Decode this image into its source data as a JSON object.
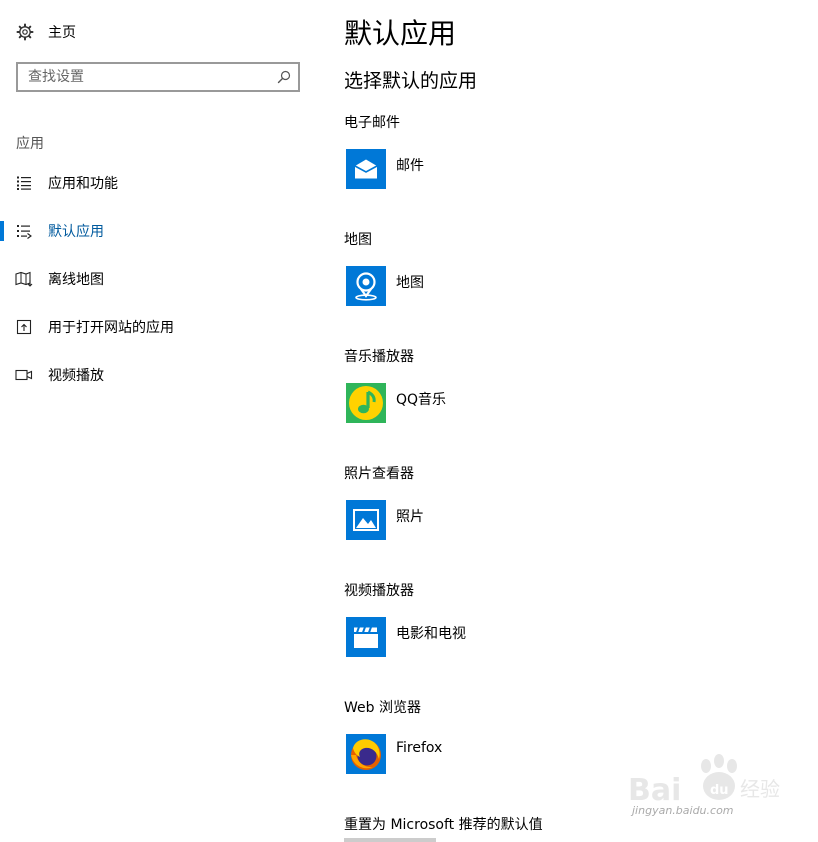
{
  "sidebar": {
    "home_label": "主页",
    "search_placeholder": "查找设置",
    "section_label": "应用",
    "items": [
      {
        "label": "应用和功能",
        "icon": "list-icon"
      },
      {
        "label": "默认应用",
        "icon": "default-apps-icon",
        "active": true
      },
      {
        "label": "离线地图",
        "icon": "offline-map-icon"
      },
      {
        "label": "用于打开网站的应用",
        "icon": "open-website-icon"
      },
      {
        "label": "视频播放",
        "icon": "video-camera-icon"
      }
    ]
  },
  "main": {
    "title": "默认应用",
    "subtitle": "选择默认的应用",
    "categories": [
      {
        "label": "电子邮件",
        "app": "邮件",
        "icon": "mail-app-icon",
        "color": "#0078d7"
      },
      {
        "label": "地图",
        "app": "地图",
        "icon": "maps-app-icon",
        "color": "#0078d7"
      },
      {
        "label": "音乐播放器",
        "app": "QQ音乐",
        "icon": "qq-music-app-icon",
        "color": "#2fb55a"
      },
      {
        "label": "照片查看器",
        "app": "照片",
        "icon": "photos-app-icon",
        "color": "#0078d7"
      },
      {
        "label": "视频播放器",
        "app": "电影和电视",
        "icon": "movies-tv-app-icon",
        "color": "#0078d7"
      },
      {
        "label": "Web 浏览器",
        "app": "Firefox",
        "icon": "firefox-app-icon",
        "color": "#0078d7"
      }
    ],
    "reset_label": "重置为 Microsoft 推荐的默认值"
  },
  "watermark": {
    "logo": "Bai 经验",
    "url": "jingyan.baidu.com"
  },
  "colors": {
    "accent": "#0078d7",
    "active_text": "#005a9e"
  }
}
